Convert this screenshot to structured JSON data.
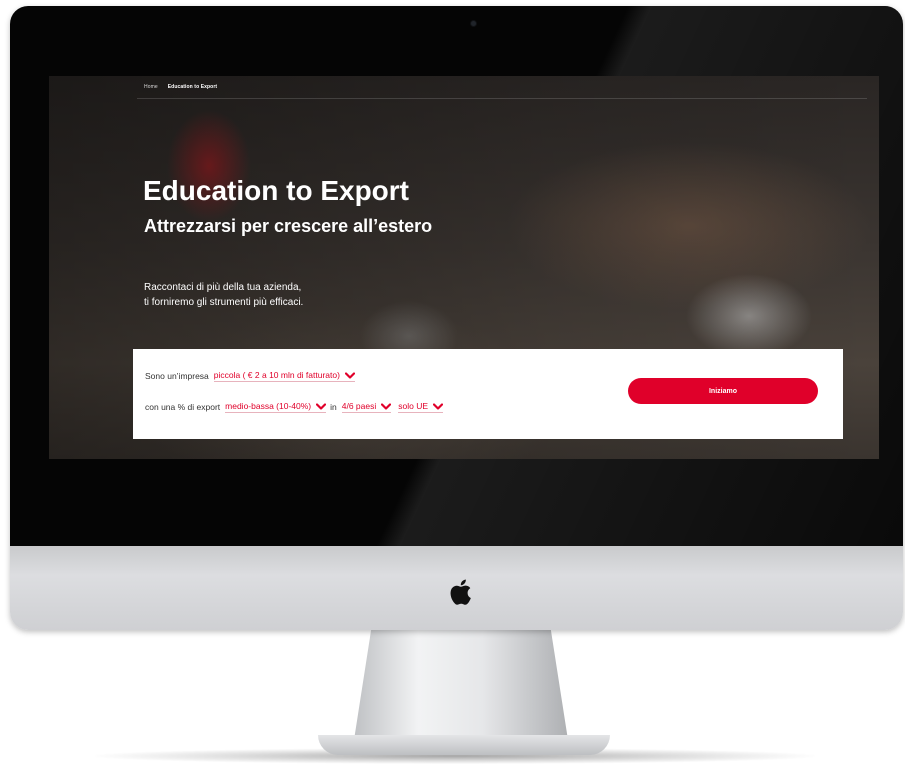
{
  "breadcrumb": {
    "home": "Home",
    "current": "Education to Export"
  },
  "hero": {
    "title": "Education to Export",
    "subtitle": "Attrezzarsi per crescere all’estero",
    "text_line1": "Raccontaci di più della tua azienda,",
    "text_line2": "ti forniremo gli strumenti più efficaci."
  },
  "form": {
    "line1_prefix": "Sono un’impresa",
    "size_value": "piccola ( € 2 a 10 mln di fatturato)",
    "line2_prefix": "con una % di export",
    "export_value": "medio-bassa (10-40%)",
    "in_text": "in",
    "countries_value": "4/6 paesi",
    "area_value": "solo UE",
    "cta_label": "Iniziamo"
  },
  "colors": {
    "accent": "#e0002a",
    "bezel": "#050505",
    "chin": "#d3d4d6"
  },
  "icons": {
    "dropdown": "chevron-down-icon",
    "brand": "apple-logo-icon"
  }
}
